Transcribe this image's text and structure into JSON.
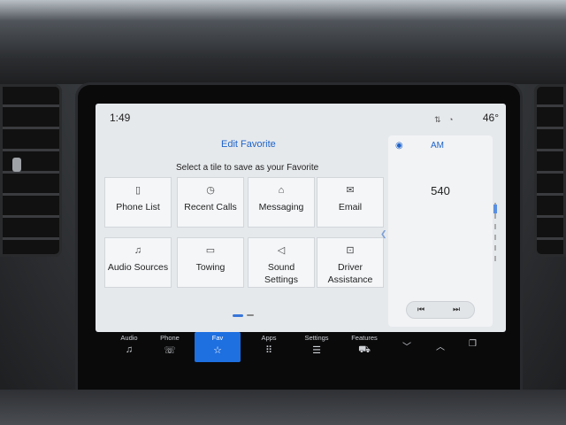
{
  "status": {
    "time": "1:49",
    "temperature": "46°"
  },
  "title": "Edit Favorite",
  "subtitle": "Select a tile to save as your Favorite",
  "tiles": [
    {
      "label": "Phone List",
      "icon": "phone-list-icon"
    },
    {
      "label": "Recent Calls",
      "icon": "clock-icon"
    },
    {
      "label": "Messaging",
      "icon": "chat-bubbles-icon"
    },
    {
      "label": "Email",
      "icon": "envelope-icon"
    },
    {
      "label": "Audio Sources",
      "icon": "audio-sources-icon"
    },
    {
      "label": "Towing",
      "icon": "trailer-icon"
    },
    {
      "label_line1": "Sound",
      "label_line2": "Settings",
      "icon": "speaker-icon"
    },
    {
      "label_line1": "Driver",
      "label_line2": "Assistance",
      "icon": "driver-assist-icon"
    }
  ],
  "radio": {
    "band": "AM",
    "frequency": "540"
  },
  "nav": [
    {
      "label": "Audio",
      "icon": "music-note-icon"
    },
    {
      "label": "Phone",
      "icon": "phone-icon"
    },
    {
      "label": "Fav",
      "icon": "star-icon",
      "active": true
    },
    {
      "label": "Apps",
      "icon": "apps-grid-icon"
    },
    {
      "label": "Settings",
      "icon": "sliders-icon"
    },
    {
      "label": "Features",
      "icon": "car-icon"
    }
  ],
  "colors": {
    "accent": "#1e6fe0",
    "title_blue": "#1f63c9",
    "screen_bg": "#e6e9ec"
  }
}
